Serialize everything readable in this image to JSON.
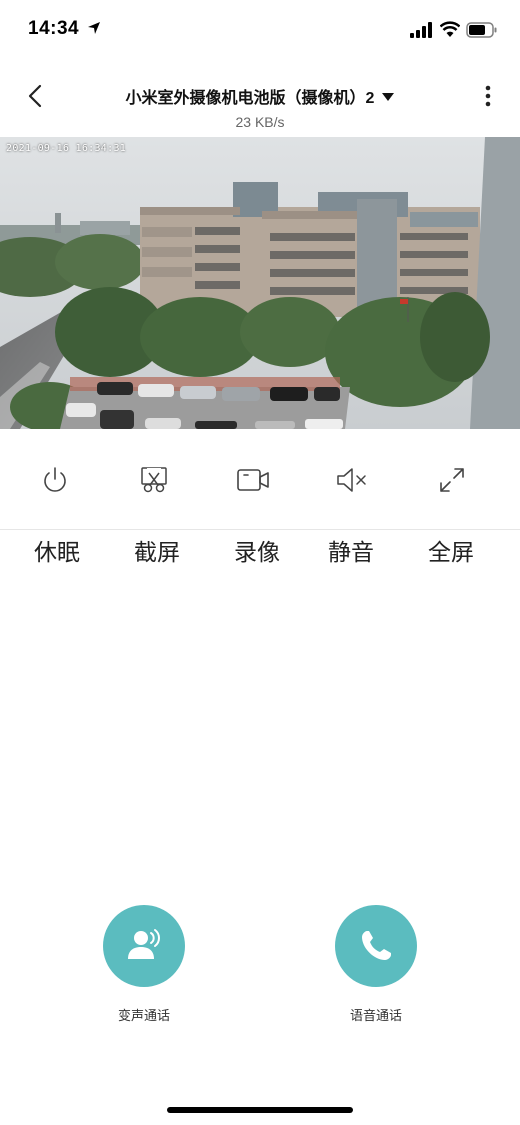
{
  "status_bar": {
    "time": "14:34"
  },
  "header": {
    "title": "小米室外摄像机电池版（摄像机）2",
    "speed": "23 KB/s"
  },
  "video": {
    "timestamp": "2021-09-16 16:34:31"
  },
  "controls": [
    {
      "icon": "power-icon",
      "label": "休眠"
    },
    {
      "icon": "scissors-icon",
      "label": "截屏"
    },
    {
      "icon": "video-camera-icon",
      "label": "录像"
    },
    {
      "icon": "speaker-mute-icon",
      "label": "静音"
    },
    {
      "icon": "expand-icon",
      "label": "全屏"
    }
  ],
  "calls": {
    "voice_change": {
      "label": "变声通话",
      "icon": "voice-change-icon"
    },
    "voice": {
      "label": "语音通话",
      "icon": "phone-icon"
    }
  },
  "colors": {
    "accent": "#5bbcbf"
  }
}
